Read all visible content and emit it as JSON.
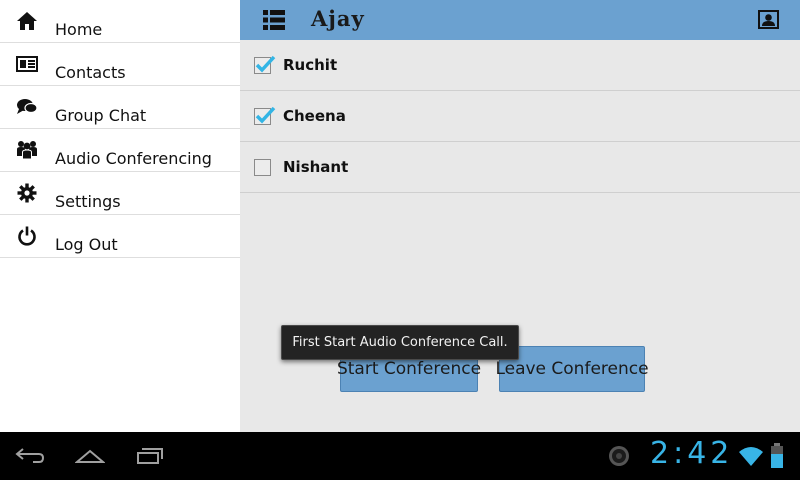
{
  "sidebar": {
    "items": [
      {
        "label": "Home",
        "icon": "home-icon"
      },
      {
        "label": "Contacts",
        "icon": "contacts-icon"
      },
      {
        "label": "Group Chat",
        "icon": "chat-icon"
      },
      {
        "label": "Audio Conferencing",
        "icon": "group-icon"
      },
      {
        "label": "Settings",
        "icon": "gear-icon"
      },
      {
        "label": "Log Out",
        "icon": "power-icon"
      }
    ]
  },
  "appbar": {
    "title": "Ajay"
  },
  "participants": [
    {
      "name": "Ruchit",
      "checked": true
    },
    {
      "name": "Cheena",
      "checked": true
    },
    {
      "name": "Nishant",
      "checked": false
    }
  ],
  "actions": {
    "start_label": "Start Conference",
    "leave_label": "Leave Conference"
  },
  "toast": {
    "message": "First Start Audio Conference Call."
  },
  "status": {
    "time": "2:42"
  },
  "colors": {
    "accent": "#6ba1d0",
    "clock": "#38b4e6",
    "check": "#33b5e5"
  }
}
